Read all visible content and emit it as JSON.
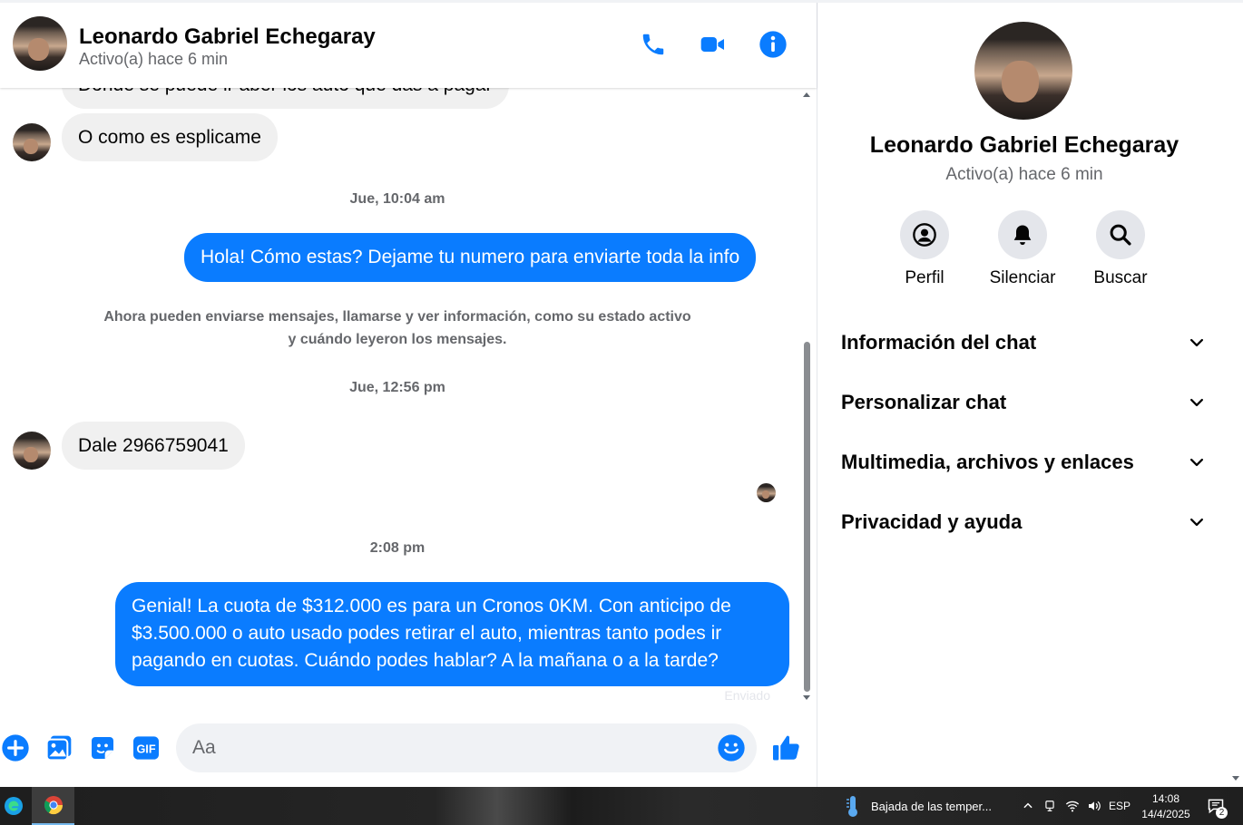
{
  "contact": {
    "name": "Leonardo Gabriel Echegaray",
    "status": "Activo(a) hace 6 min"
  },
  "header": {
    "icons": [
      "phone-icon",
      "video-call-icon",
      "info-icon"
    ]
  },
  "messages": {
    "partial_top": "Donde se puede ir aber los auto que das a pagar",
    "incoming_1": "O como es esplicame",
    "timestamp_1": "Jue, 10:04 am",
    "outgoing_1": "Hola! Cómo estas? Dejame tu numero para enviarte toda la info",
    "system_note": "Ahora pueden enviarse mensajes, llamarse y ver información, como su estado activo y cuándo leyeron los mensajes.",
    "timestamp_2": "Jue, 12:56 pm",
    "incoming_2": "Dale 2966759041",
    "timestamp_3": "2:08 pm",
    "outgoing_2": "Genial! La cuota de $312.000 es para un Cronos 0KM. Con anticipo de $3.500.000 o auto usado podes retirar el auto, mientras tanto podes ir pagando en cuotas. Cuándo podes hablar? A la mañana o a la tarde?",
    "sent_status": "Enviado"
  },
  "composer": {
    "placeholder": "Aa",
    "icons": [
      "plus-icon",
      "image-icon",
      "sticker-icon",
      "gif-icon",
      "emoji-icon",
      "thumbs-up-icon"
    ],
    "gif_label": "GIF"
  },
  "panel": {
    "actions": [
      {
        "label": "Perfil",
        "icon": "profile-icon"
      },
      {
        "label": "Silenciar",
        "icon": "bell-icon"
      },
      {
        "label": "Buscar",
        "icon": "search-icon"
      }
    ],
    "sections": [
      "Información del chat",
      "Personalizar chat",
      "Multimedia, archivos y enlaces",
      "Privacidad y ayuda"
    ]
  },
  "taskbar": {
    "weather": "Bajada de las temper...",
    "language": "ESP",
    "time": "14:08",
    "date": "14/4/2025",
    "notifications": "2"
  },
  "colors": {
    "accent": "#0a7cff",
    "bubble_in": "#f0f0f0",
    "secondary_text": "#65676b"
  }
}
